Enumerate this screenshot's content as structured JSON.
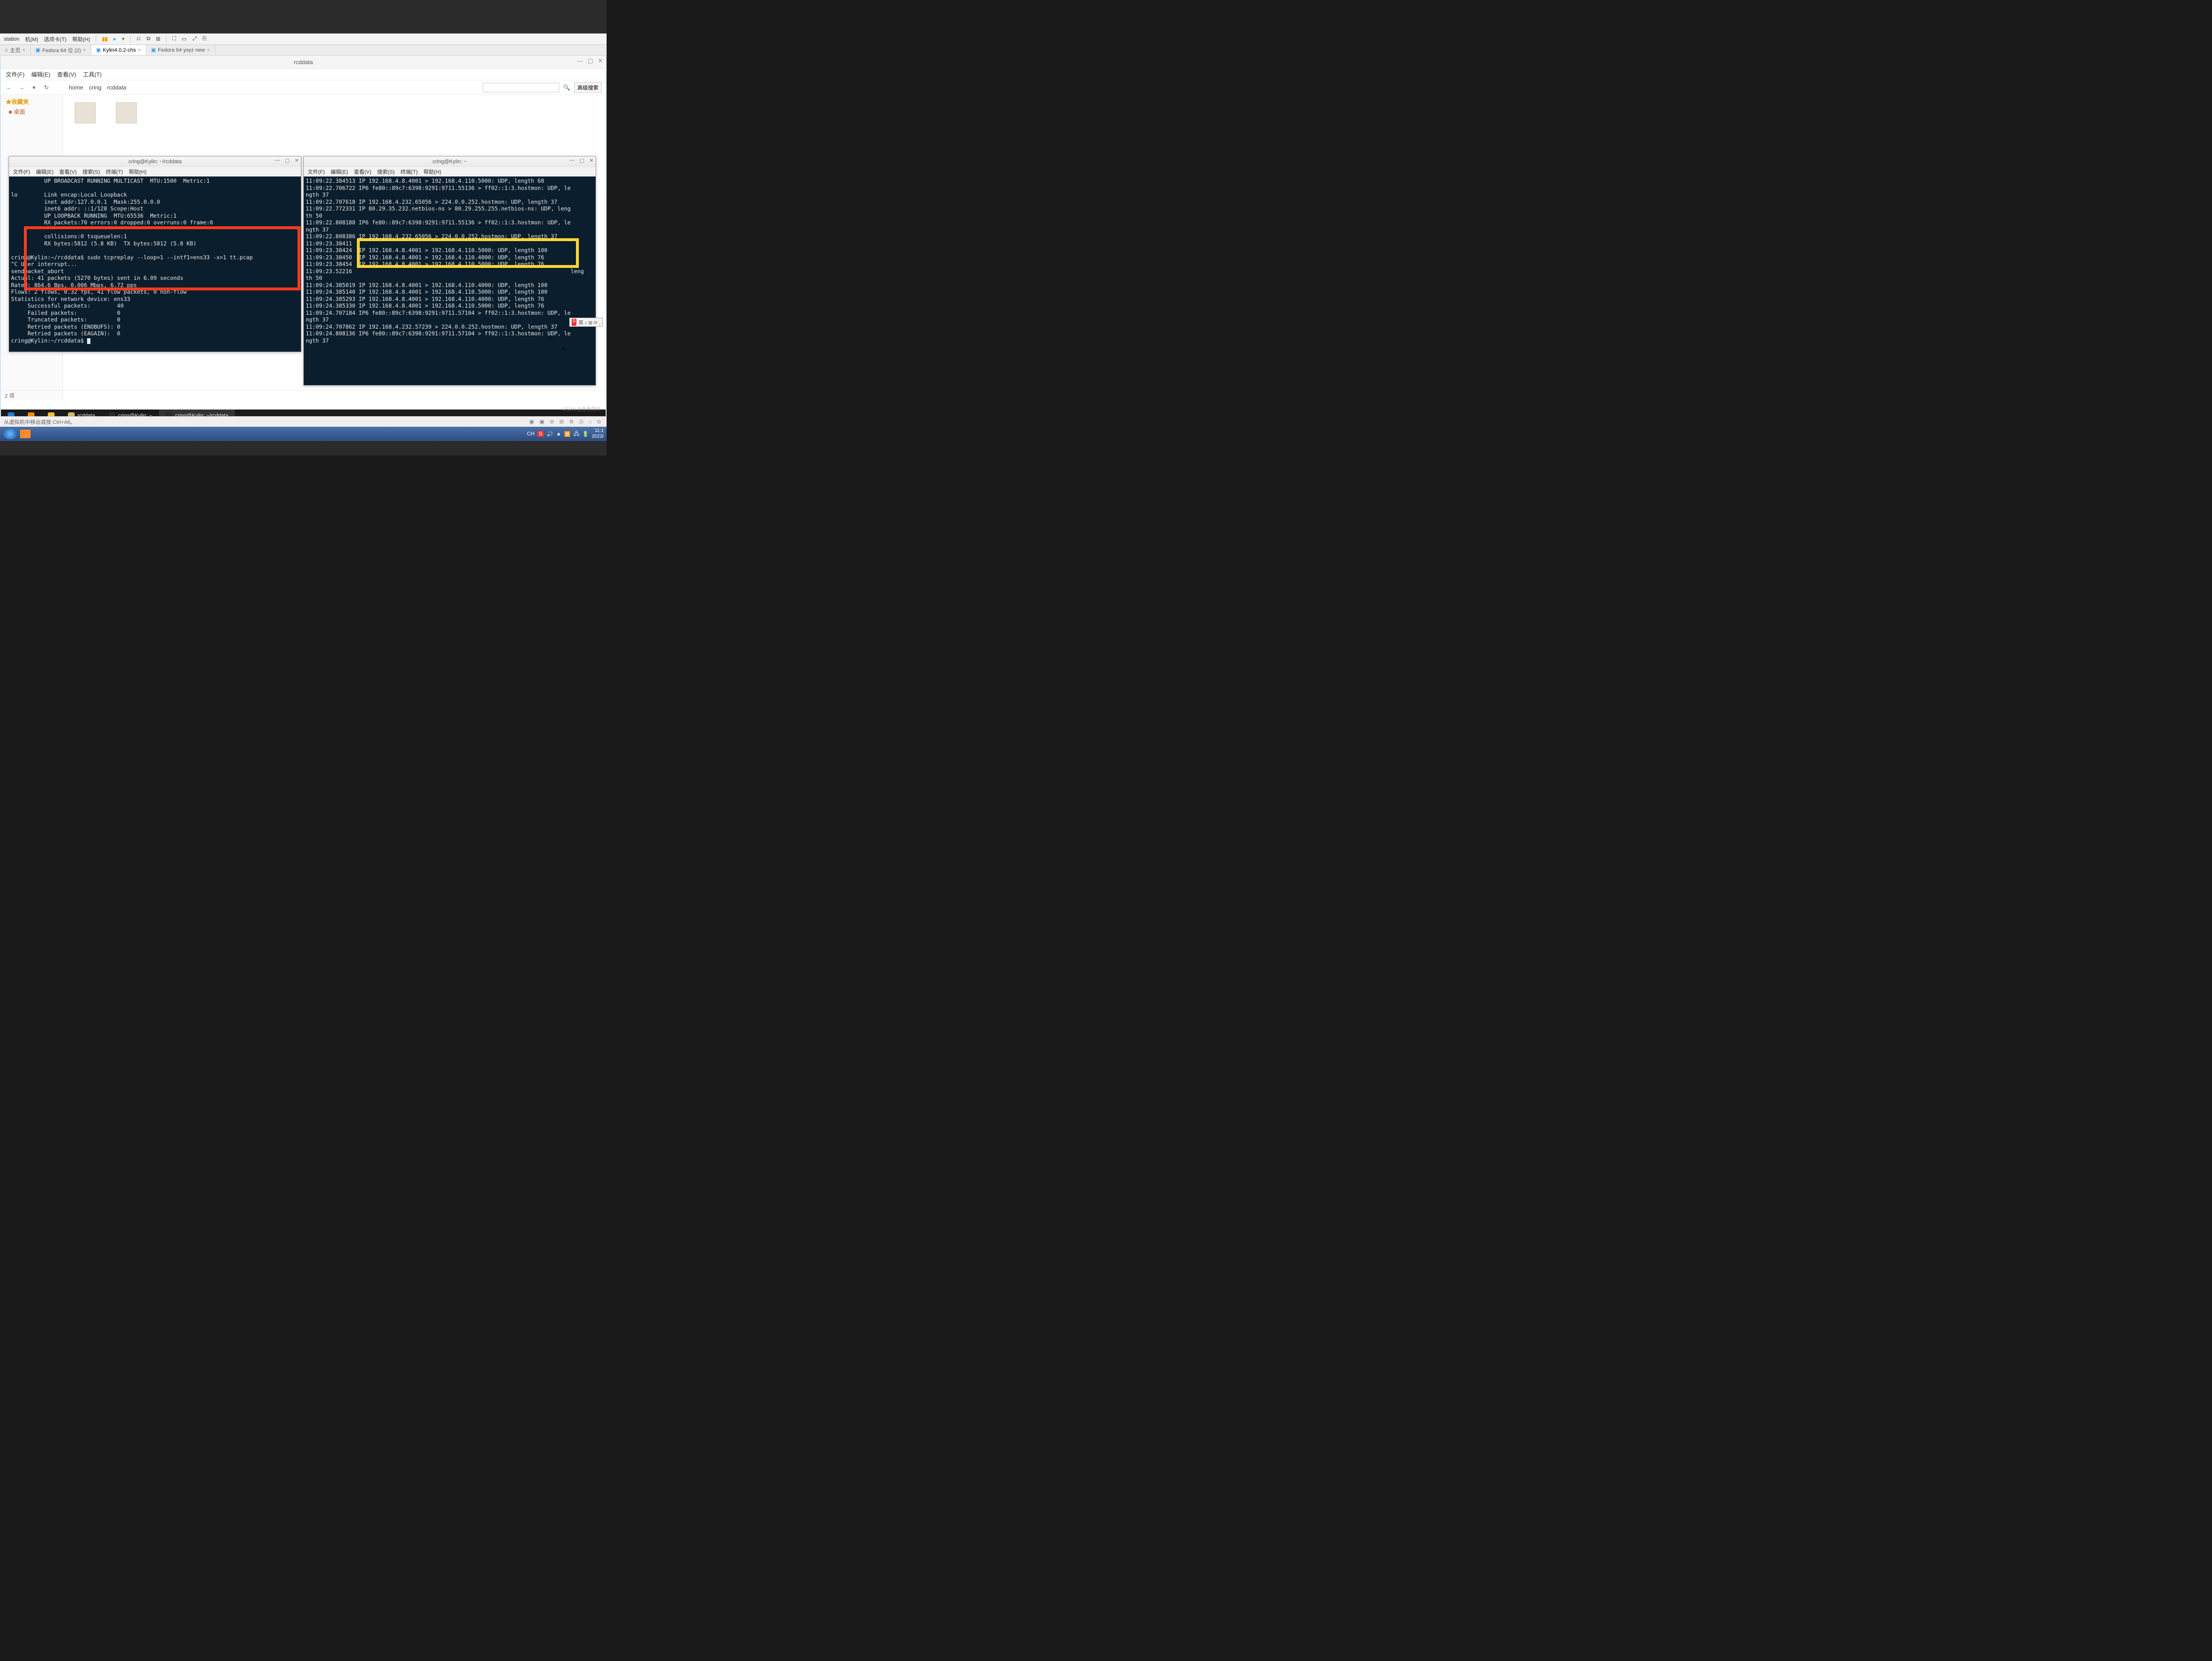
{
  "vm_toolbar": {
    "items": [
      "station",
      "机(M)",
      "选项卡(T)",
      "帮助(H)"
    ]
  },
  "vm_tabs": [
    {
      "icon": "home",
      "label": "主页"
    },
    {
      "icon": "os",
      "label": "Fedora 64 位 (2)"
    },
    {
      "icon": "os",
      "label": "Kylin4.0.2-chs",
      "active": true
    },
    {
      "icon": "os",
      "label": "Fedora 64 ysyz new"
    }
  ],
  "fm": {
    "title": "rcddata",
    "menu": [
      "文件(F)",
      "编辑(E)",
      "查看(V)",
      "工具(T)"
    ],
    "nav_arrows": [
      "←",
      "→",
      "▾",
      "↻"
    ],
    "path": [
      "home",
      "cring",
      "rcddata"
    ],
    "search_placeholder": "",
    "adv_search": "高级搜索",
    "sidebar": {
      "favorites": "★收藏夹",
      "desktop": "■ 桌面"
    },
    "status": "2 项"
  },
  "term1": {
    "title": "cring@Kylin: ~/rcddata",
    "menu": [
      "文件(F)",
      "编辑(E)",
      "查看(V)",
      "搜索(S)",
      "终端(T)",
      "帮助(H)"
    ],
    "lines": [
      "          UP BROADCAST RUNNING MULTICAST  MTU:1500  Metric:1",
      "",
      "lo        Link encap:Local Loopback",
      "          inet addr:127.0.0.1  Mask:255.0.0.0",
      "          inet6 addr: ::1/128 Scope:Host",
      "          UP LOOPBACK RUNNING  MTU:65536  Metric:1",
      "          RX packets:70 errors:0 dropped:0 overruns:0 frame:0",
      "",
      "          collisions:0 txqueuelen:1",
      "          RX bytes:5812 (5.8 KB)  TX bytes:5812 (5.8 KB)",
      "",
      "cring@Kylin:~/rcddata$ sudo tcpreplay --loop=1 --intf1=ens33 -x=1 tt.pcap",
      "^C User interrupt...",
      "sendpacket_abort",
      "Actual: 41 packets (5270 bytes) sent in 6.09 seconds",
      "Rated: 864.6 Bps, 0.006 Mbps, 6.72 pps",
      "Flows: 2 flows, 0.32 fps, 41 flow packets, 0 non-flow",
      "Statistics for network device: ens33",
      "     Successful packets:        40",
      "     Failed packets:            0",
      "     Truncated packets:         0",
      "     Retried packets (ENOBUFS): 0",
      "     Retried packets (EAGAIN):  0",
      "cring@Kylin:~/rcddata$ "
    ]
  },
  "term2": {
    "title": "cring@Kylin: ~",
    "menu": [
      "文件(F)",
      "编辑(E)",
      "查看(V)",
      "搜索(S)",
      "终端(T)",
      "帮助(H)"
    ],
    "lines": [
      "11:09:22.384513 IP 192.168.4.8.4001 > 192.168.4.110.5000: UDP, length 68",
      "11:09:22.706722 IP6 fe80::89c7:6398:9291:9711.55136 > ff02::1:3.hostmon: UDP, le",
      "ngth 37",
      "11:09:22.707618 IP 192.168.4.232.65056 > 224.0.0.252.hostmon: UDP, length 37",
      "11:09:22.772331 IP 80.29.35.232.netbios-ns > 80.29.255.255.netbios-ns: UDP, leng",
      "th 50",
      "11:09:22.808188 IP6 fe80::89c7:6398:9291:9711.55136 > ff02::1:3.hostmon: UDP, le",
      "ngth 37",
      "11:09:22.808386 IP 192.168.4.232.65056 > 224.0.0.252.hostmon: UDP, length 37",
      "11:09:23.38411",
      "11:09:23.38424  IP 192.168.4.8.4001 > 192.168.4.110.5000: UDP, length 100",
      "11:09:23.38450  IP 192.168.4.8.4001 > 192.168.4.110.4000: UDP, length 76",
      "11:09:23.38454  IP 192.168.4.8.4001 > 192.168.4.110.5000: UDP, length 76",
      "11:09:23.52216                                                                  leng",
      "th 50",
      "11:09:24.385019 IP 192.168.4.8.4001 > 192.168.4.110.4000: UDP, length 100",
      "11:09:24.385140 IP 192.168.4.8.4001 > 192.168.4.110.5000: UDP, length 100",
      "11:09:24.385293 IP 192.168.4.8.4001 > 192.168.4.110.4000: UDP, length 76",
      "11:09:24.385330 IP 192.168.4.8.4001 > 192.168.4.110.5000: UDP, length 76",
      "11:09:24.707184 IP6 fe80::89c7:6398:9291:9711.57104 > ff02::1:3.hostmon: UDP, le",
      "ngth 37",
      "11:09:24.707862 IP 192.168.4.232.57239 > 224.0.0.252.hostmon: UDP, length 37",
      "11:09:24.808136 IP6 fe80::89c7:6398:9291:9711.57104 > ff02::1:3.hostmon: UDP, le",
      "ngth 37"
    ]
  },
  "guest_taskbar": {
    "items": [
      {
        "label": "",
        "icon": "#1e7fd4"
      },
      {
        "label": "",
        "icon": "#ff8a00"
      },
      {
        "label": "",
        "icon": "#f3c233"
      },
      {
        "label": "rcddata",
        "icon": "#d8b868"
      },
      {
        "label": "cring@Kylin: ~",
        "icon": "#2a2a2a"
      },
      {
        "label": "cring@Kylin: ~/rcddata",
        "icon": "#2a2a2a",
        "active": true
      }
    ]
  },
  "vm_status": {
    "left": "从虚拟机中移出或按 Ctrl+Alt。",
    "right_icons": 8
  },
  "host": {
    "ime": "CH",
    "clock_time": "11:1",
    "clock_date": "2023/"
  },
  "ime_float": "英 ♪ ⊞ ⟳ ,",
  "watermark": "CSDN @金色阳光"
}
